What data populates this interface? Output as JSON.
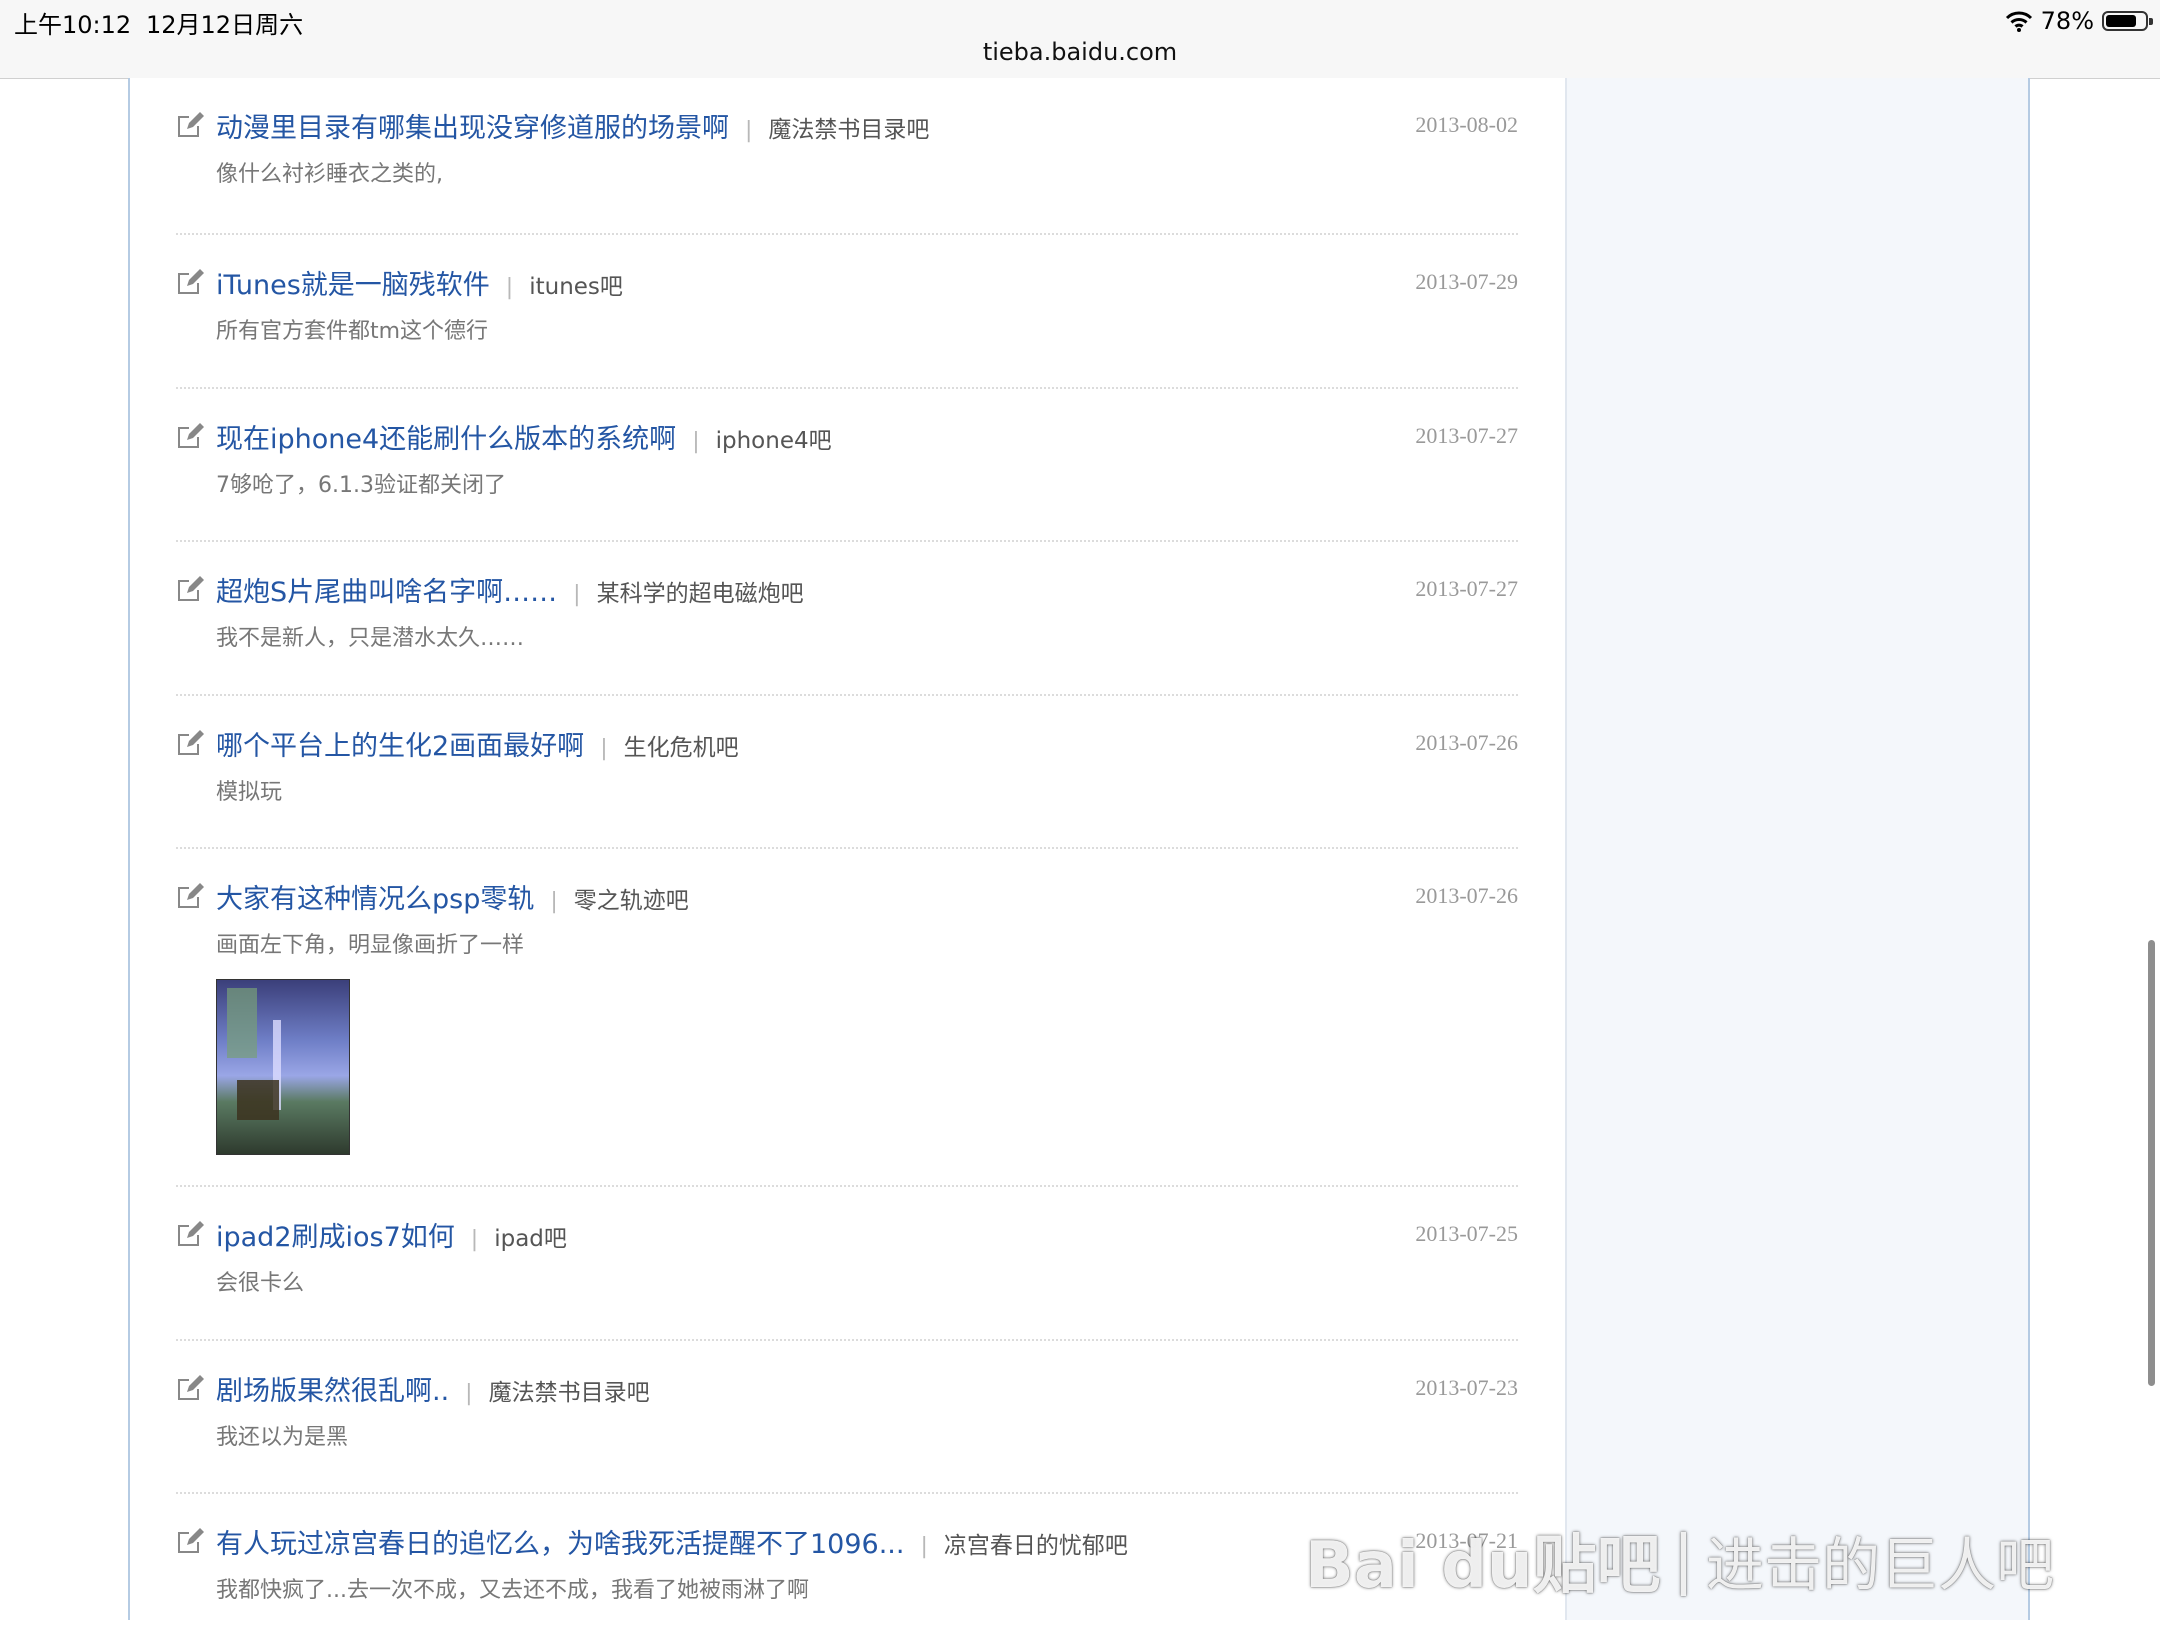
{
  "status": {
    "time": "上午10:12",
    "date": "12月12日周六",
    "battery": "78%",
    "battery_level": 0.78
  },
  "browser": {
    "url": "tieba.baidu.com"
  },
  "posts": [
    {
      "title": "动漫里目录有哪集出现没穿修道服的场景啊",
      "forum": "魔法禁书目录吧",
      "snippet": "像什么衬衫睡衣之类的,",
      "date": "2013-08-02"
    },
    {
      "title": "iTunes就是一脑残软件",
      "forum": "itunes吧",
      "snippet": "所有官方套件都tm这个德行",
      "date": "2013-07-29"
    },
    {
      "title": "现在iphone4还能刷什么版本的系统啊",
      "forum": "iphone4吧",
      "snippet": "7够呛了，6.1.3验证都关闭了",
      "date": "2013-07-27"
    },
    {
      "title": "超炮S片尾曲叫啥名字啊……",
      "forum": "某科学的超电磁炮吧",
      "snippet": "我不是新人，只是潜水太久……",
      "date": "2013-07-27"
    },
    {
      "title": "哪个平台上的生化2画面最好啊",
      "forum": "生化危机吧",
      "snippet": "模拟玩",
      "date": "2013-07-26"
    },
    {
      "title": "大家有这种情况么psp零轨",
      "forum": "零之轨迹吧",
      "snippet": "画面左下角，明显像画折了一样",
      "date": "2013-07-26",
      "has_image": true
    },
    {
      "title": "ipad2刷成ios7如何",
      "forum": "ipad吧",
      "snippet": "会很卡么",
      "date": "2013-07-25"
    },
    {
      "title": "剧场版果然很乱啊..",
      "forum": "魔法禁书目录吧",
      "snippet": "我还以为是黑",
      "date": "2013-07-23"
    },
    {
      "title": "有人玩过凉宫春日的追忆么，为啥我死活提醒不了1096...",
      "forum": "凉宫春日的忧郁吧",
      "snippet": "我都快疯了...去一次不成，又去还不成，我看了她被雨淋了啊",
      "date": "2013-07-21"
    }
  ],
  "watermark": {
    "brand": "Bai du贴吧",
    "forum": "进击的巨人吧"
  },
  "icons": {
    "post": "edit-icon",
    "wifi": "wifi-icon",
    "battery": "battery-icon"
  }
}
